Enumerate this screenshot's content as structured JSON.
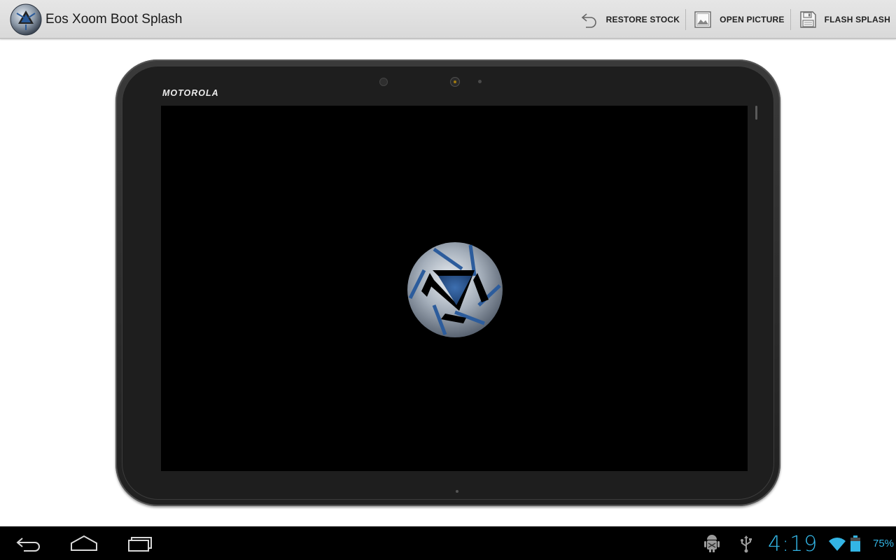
{
  "app": {
    "title": "Eos Xoom Boot Splash",
    "icon": "aperture-logo-icon"
  },
  "actions": [
    {
      "label": "RESTORE STOCK",
      "icon": "undo-icon"
    },
    {
      "label": "OPEN PICTURE",
      "icon": "picture-icon"
    },
    {
      "label": "FLASH SPLASH",
      "icon": "save-disk-icon"
    }
  ],
  "preview": {
    "device_brand": "MOTOROLA",
    "splash_image": "aperture-logo-icon"
  },
  "system_bar": {
    "nav": [
      "back-icon",
      "home-icon",
      "recent-apps-icon"
    ],
    "status_icons": [
      "android-debug-icon",
      "usb-icon",
      "wifi-icon",
      "battery-icon"
    ],
    "clock": "4:19",
    "battery": "75%"
  },
  "colors": {
    "accent": "#33b5e5",
    "action_bar": "#e0e0e0",
    "logo_blue": "#2a5a99"
  }
}
